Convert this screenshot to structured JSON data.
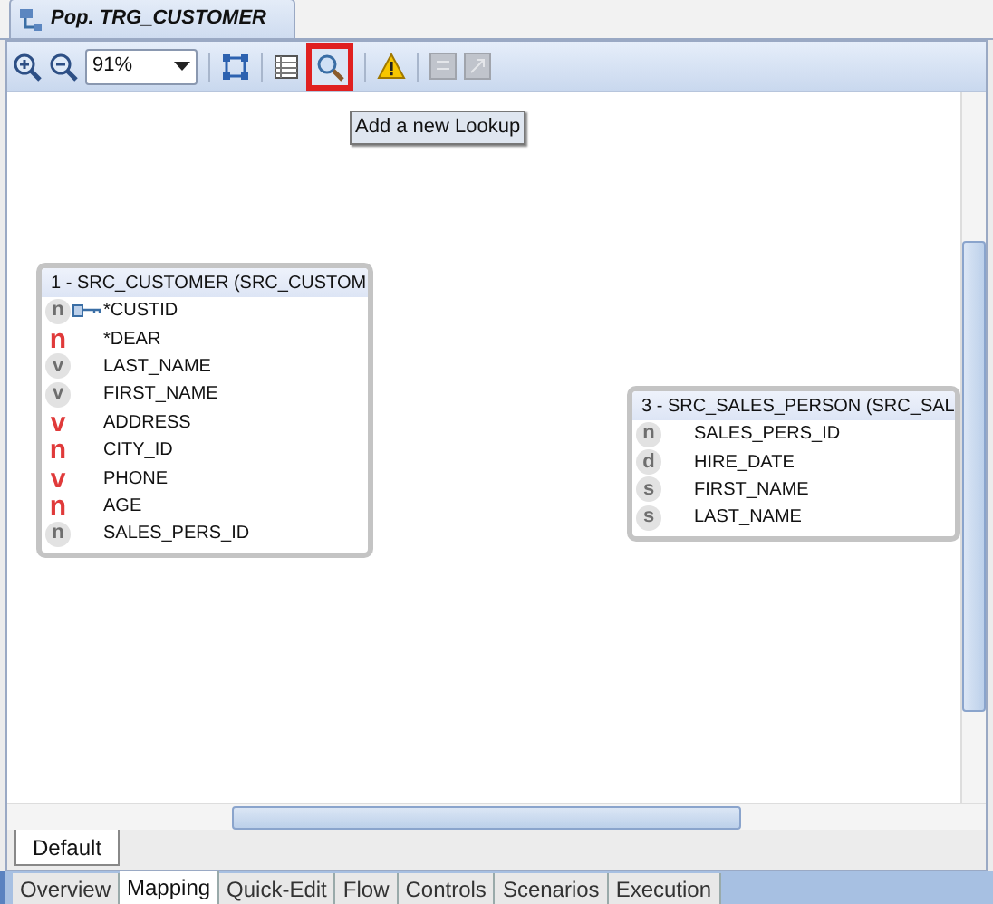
{
  "editor_tab": {
    "title": "Pop. TRG_CUSTOMER"
  },
  "toolbar": {
    "zoom": "91%",
    "tooltip": "Add a new Lookup"
  },
  "datastores": [
    {
      "title": "1 - SRC_CUSTOMER (SRC_CUSTOM",
      "columns": [
        {
          "type": "n",
          "active": false,
          "key": true,
          "name": "*CUSTID"
        },
        {
          "type": "n",
          "active": true,
          "key": false,
          "name": "*DEAR"
        },
        {
          "type": "v",
          "active": false,
          "key": false,
          "name": "LAST_NAME"
        },
        {
          "type": "v",
          "active": false,
          "key": false,
          "name": "FIRST_NAME"
        },
        {
          "type": "v",
          "active": true,
          "key": false,
          "name": "ADDRESS"
        },
        {
          "type": "n",
          "active": true,
          "key": false,
          "name": "CITY_ID"
        },
        {
          "type": "v",
          "active": true,
          "key": false,
          "name": "PHONE"
        },
        {
          "type": "n",
          "active": true,
          "key": false,
          "name": "AGE"
        },
        {
          "type": "n",
          "active": false,
          "key": false,
          "name": "SALES_PERS_ID"
        }
      ]
    },
    {
      "title": "3 - SRC_SALES_PERSON (SRC_SAL",
      "columns": [
        {
          "type": "n",
          "active": false,
          "key": false,
          "name": "SALES_PERS_ID"
        },
        {
          "type": "d",
          "active": false,
          "key": false,
          "name": "HIRE_DATE"
        },
        {
          "type": "s",
          "active": false,
          "key": false,
          "name": "FIRST_NAME"
        },
        {
          "type": "s",
          "active": false,
          "key": false,
          "name": "LAST_NAME"
        }
      ]
    }
  ],
  "diagram_tabs": [
    {
      "label": "Default",
      "selected": true
    }
  ],
  "bottom_tabs": [
    {
      "label": "Overview",
      "selected": false
    },
    {
      "label": "Mapping",
      "selected": true
    },
    {
      "label": "Quick-Edit",
      "selected": false
    },
    {
      "label": "Flow",
      "selected": false
    },
    {
      "label": "Controls",
      "selected": false
    },
    {
      "label": "Scenarios",
      "selected": false
    },
    {
      "label": "Execution",
      "selected": false
    }
  ]
}
